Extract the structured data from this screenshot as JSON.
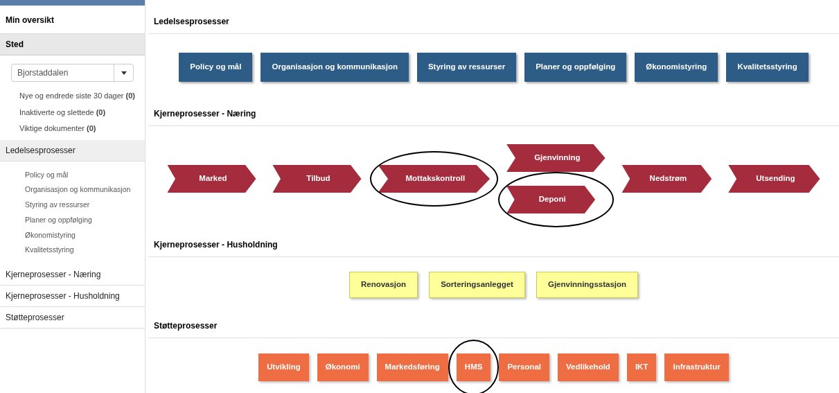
{
  "sidebar": {
    "overview": "Min oversikt",
    "place_heading": "Sted",
    "place_select": {
      "value": "Bjorstaddalen"
    },
    "place_links": [
      "Nye og endrede siste 30 dager **(0)**",
      "Inaktiverte og slettede **(0)**",
      "Viktige dokumenter **(0)**"
    ],
    "sections": [
      {
        "label": "Ledelsesprosesser",
        "expanded": true,
        "children": [
          "Policy og mål",
          "Organisasjon og kommunikasjon",
          "Styring av ressurser",
          "Planer og oppfølging",
          "Økonomistyring",
          "Kvalitetsstyring"
        ]
      },
      {
        "label": "Kjerneprosesser - Næring",
        "expanded": false
      },
      {
        "label": "Kjerneprosesser - Husholdning",
        "expanded": false
      },
      {
        "label": "Støtteprosesser",
        "expanded": false
      }
    ]
  },
  "groups": [
    {
      "title": "Ledelsesprosesser",
      "kind": "blue",
      "items": [
        {
          "label": "Policy og mål",
          "circled": false
        },
        {
          "label": "Organisasjon og kommunikasjon",
          "circled": false
        },
        {
          "label": "Styring av ressurser",
          "circled": false
        },
        {
          "label": "Planer og oppfølging",
          "circled": false
        },
        {
          "label": "Økonomistyring",
          "circled": false
        },
        {
          "label": "Kvalitetsstyring",
          "circled": false
        }
      ]
    },
    {
      "title": "Kjerneprosesser - Næring",
      "kind": "chevron",
      "items": [
        {
          "label": "Marked",
          "circled": false
        },
        {
          "label": "Tilbud",
          "circled": false
        },
        {
          "label": "Mottakskontroll",
          "circled": true
        },
        {
          "stack": [
            {
              "label": "Gjenvinning",
              "circled": false
            },
            {
              "label": "Deponi",
              "circled": true
            }
          ]
        },
        {
          "label": "Nedstrøm",
          "circled": false
        },
        {
          "label": "Utsending",
          "circled": false
        }
      ]
    },
    {
      "title": "Kjerneprosesser - Husholdning",
      "kind": "yellow",
      "items": [
        {
          "label": "Renovasjon",
          "circled": false
        },
        {
          "label": "Sorteringsanlegget",
          "circled": false
        },
        {
          "label": "Gjenvinningsstasjon",
          "circled": false
        }
      ]
    },
    {
      "title": "Støtteprosesser",
      "kind": "orange",
      "items": [
        {
          "label": "Utvikling",
          "circled": false
        },
        {
          "label": "Økonomi",
          "circled": false
        },
        {
          "label": "Markedsføring",
          "circled": false
        },
        {
          "label": "HMS",
          "circled": true
        },
        {
          "label": "Personal",
          "circled": false
        },
        {
          "label": "Vedlikehold",
          "circled": false
        },
        {
          "label": "IKT",
          "circled": false
        },
        {
          "label": "Infrastruktur",
          "circled": false
        }
      ]
    }
  ]
}
